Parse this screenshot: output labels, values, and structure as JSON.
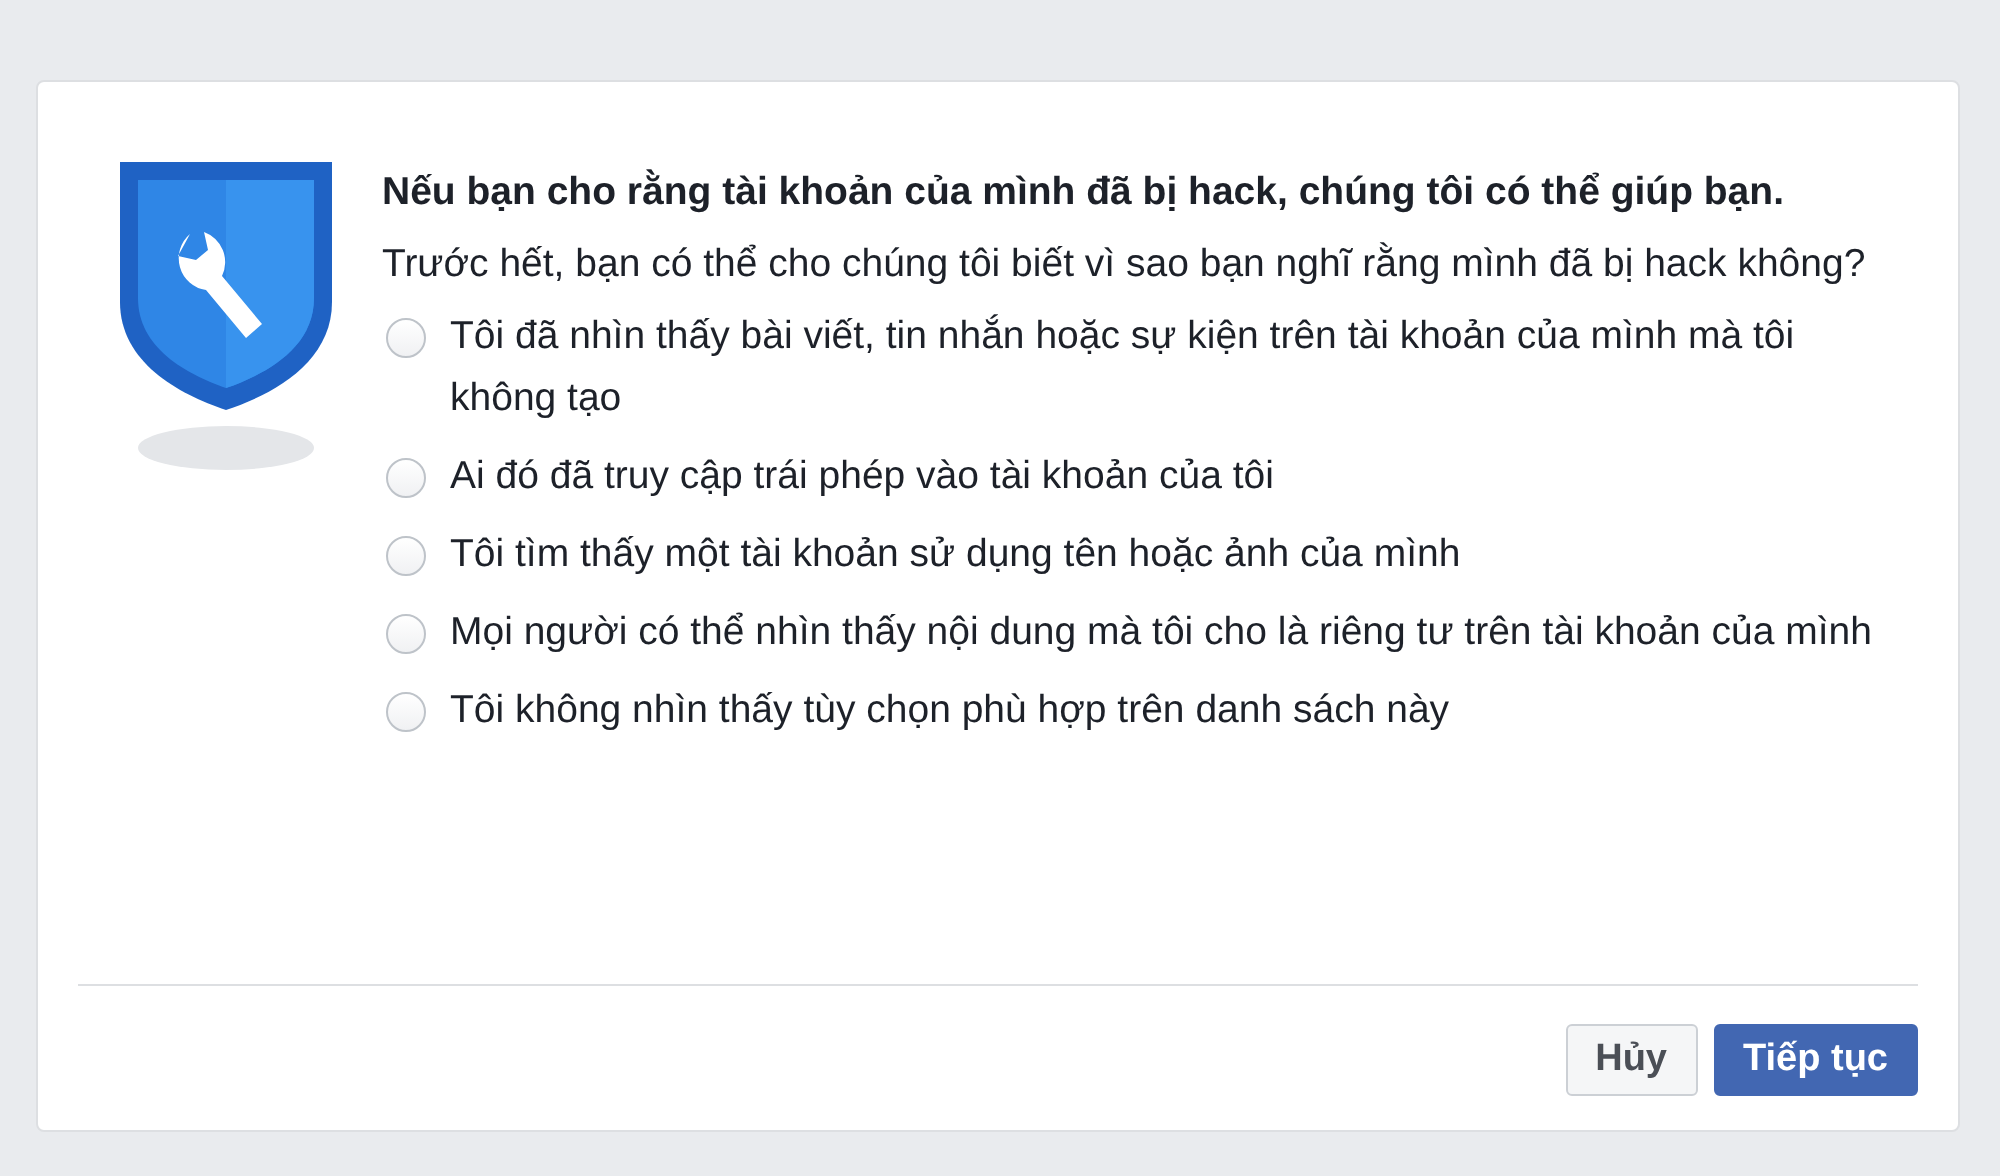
{
  "heading": "Nếu bạn cho rằng tài khoản của mình đã bị hack, chúng tôi có thể giúp bạn.",
  "question": "Trước hết, bạn có thể cho chúng tôi biết vì sao bạn nghĩ rằng mình đã bị hack không?",
  "options": [
    {
      "label": "Tôi đã nhìn thấy bài viết, tin nhắn hoặc sự kiện trên tài khoản của mình mà tôi không tạo",
      "selected": false
    },
    {
      "label": "Ai đó đã truy cập trái phép vào tài khoản của tôi",
      "selected": false
    },
    {
      "label": "Tôi tìm thấy một tài khoản sử dụng tên hoặc ảnh của mình",
      "selected": false
    },
    {
      "label": "Mọi người có thể nhìn thấy nội dung mà tôi cho là riêng tư trên tài khoản của mình",
      "selected": false
    },
    {
      "label": "Tôi không nhìn thấy tùy chọn phù hợp trên danh sách này",
      "selected": false
    }
  ],
  "buttons": [
    {
      "label": "Hủy",
      "kind": "secondary"
    },
    {
      "label": "Tiếp tục",
      "kind": "primary"
    }
  ]
}
